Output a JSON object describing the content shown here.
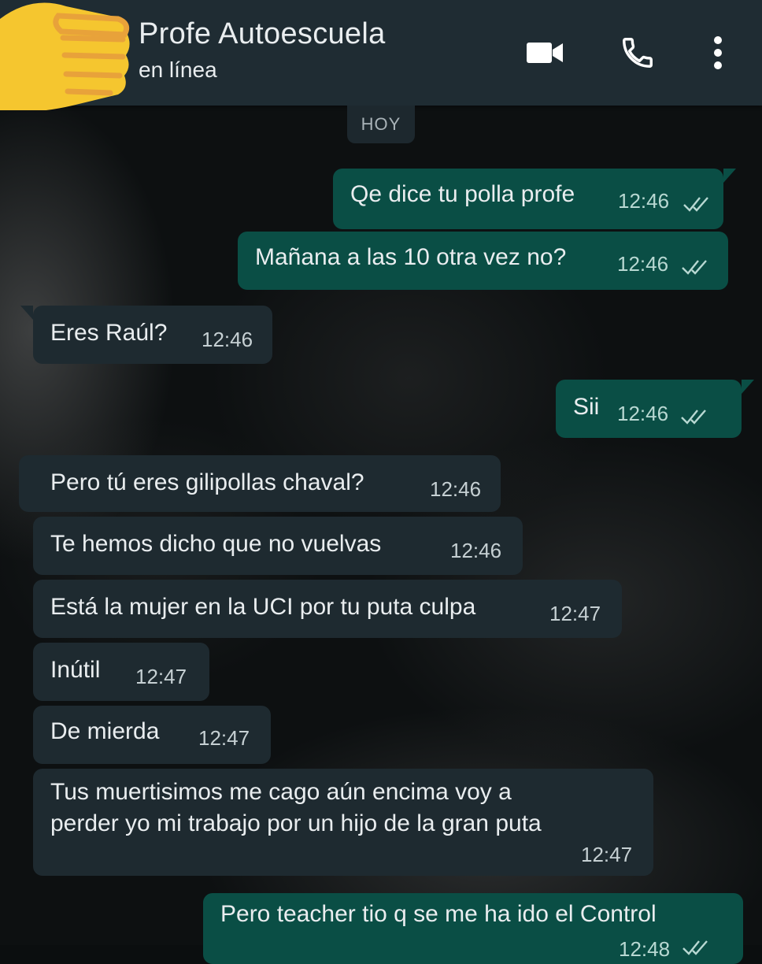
{
  "header": {
    "title": "Profe Autoescuela",
    "status": "en línea",
    "actions": [
      {
        "name": "video-call",
        "icon": "video-camera-icon"
      },
      {
        "name": "voice-call",
        "icon": "phone-icon"
      },
      {
        "name": "more-options",
        "icon": "vertical-dots-icon"
      }
    ],
    "avatar_icon": "thumbs-up-emoji"
  },
  "date_chip": "HOY",
  "messages": [
    {
      "direction": "outgoing",
      "text": "Qe dice tu polla profe",
      "time": "12:46",
      "status": "read"
    },
    {
      "direction": "outgoing",
      "text": "Mañana a las 10 otra vez no?",
      "time": "12:46",
      "status": "read"
    },
    {
      "direction": "incoming",
      "text": "Eres Raúl?",
      "time": "12:46"
    },
    {
      "direction": "outgoing",
      "text": "Sii",
      "time": "12:46",
      "status": "read"
    },
    {
      "direction": "incoming",
      "text": "Pero tú eres gilipollas chaval?",
      "time": "12:46"
    },
    {
      "direction": "incoming",
      "text": "Te hemos dicho que no vuelvas",
      "time": "12:46"
    },
    {
      "direction": "incoming",
      "text": "Está la mujer en la UCI por tu puta culpa",
      "time": "12:47"
    },
    {
      "direction": "incoming",
      "text": "Inútil",
      "time": "12:47"
    },
    {
      "direction": "incoming",
      "text": "De mierda",
      "time": "12:47"
    },
    {
      "direction": "incoming",
      "text": "Tus muertisimos me cago aún encima voy a\nperder yo mi trabajo por un hijo de la gran puta",
      "time": "12:47"
    },
    {
      "direction": "outgoing",
      "text": "Pero teacher tio q se me ha ido el Control",
      "time": "12:48",
      "status": "read"
    }
  ],
  "colors": {
    "header_bg": "#1f2c33",
    "incoming_bubble": "#1e2a30",
    "outgoing_bubble": "#0a4e45",
    "read_ticks": "#b8d8d2",
    "avatar_yellow": "#f5c62f"
  }
}
